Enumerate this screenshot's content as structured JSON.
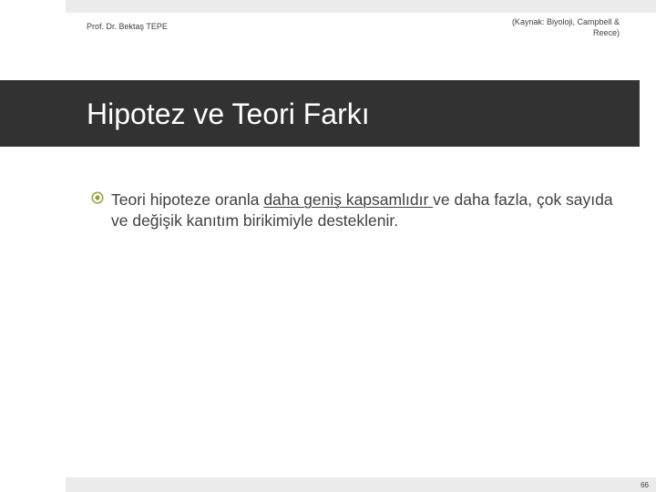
{
  "header": {
    "author": "Prof. Dr. Bektaş TEPE",
    "source_line1": "(Kaynak: Biyoloji, Campbell &",
    "source_line2": "Reece)"
  },
  "title": "Hipotez ve Teori Farkı",
  "bullet": {
    "icon": "circle-target-icon",
    "text_before": "Teori hipoteze oranla ",
    "text_underlined": "daha geniş kapsamlıdır ",
    "text_after": "ve daha fazla, çok sayıda ve değişik kanıtım birikimiyle desteklenir."
  },
  "footer": {
    "page_number": "66"
  },
  "colors": {
    "title_band": "#323232",
    "accent_bars": "#ebebeb",
    "text": "#404040",
    "bullet_icon": "#9aa13a"
  }
}
